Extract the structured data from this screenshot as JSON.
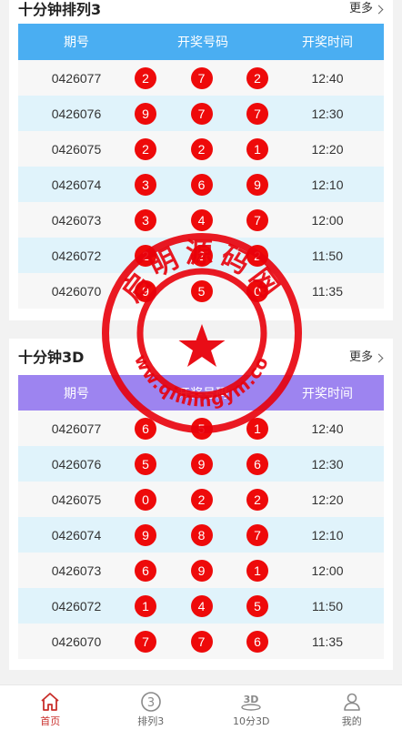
{
  "section1": {
    "title": "十分钟排列3",
    "more": "更多",
    "headers": [
      "期号",
      "开奖号码",
      "开奖时间"
    ],
    "rows": [
      {
        "issue": "0426077",
        "nums": [
          "2",
          "7",
          "2"
        ],
        "time": "12:40"
      },
      {
        "issue": "0426076",
        "nums": [
          "9",
          "7",
          "7"
        ],
        "time": "12:30"
      },
      {
        "issue": "0426075",
        "nums": [
          "2",
          "2",
          "1"
        ],
        "time": "12:20"
      },
      {
        "issue": "0426074",
        "nums": [
          "3",
          "6",
          "9"
        ],
        "time": "12:10"
      },
      {
        "issue": "0426073",
        "nums": [
          "3",
          "4",
          "7"
        ],
        "time": "12:00"
      },
      {
        "issue": "0426072",
        "nums": [
          "2",
          "2",
          "2"
        ],
        "time": "11:50"
      },
      {
        "issue": "0426070",
        "nums": [
          "9",
          "5",
          "0"
        ],
        "time": "11:35"
      }
    ]
  },
  "section2": {
    "title": "十分钟3D",
    "more": "更多",
    "headers": [
      "期号",
      "开奖号码",
      "开奖时间"
    ],
    "rows": [
      {
        "issue": "0426077",
        "nums": [
          "6",
          "5",
          "1"
        ],
        "time": "12:40"
      },
      {
        "issue": "0426076",
        "nums": [
          "5",
          "9",
          "6"
        ],
        "time": "12:30"
      },
      {
        "issue": "0426075",
        "nums": [
          "0",
          "2",
          "2"
        ],
        "time": "12:20"
      },
      {
        "issue": "0426074",
        "nums": [
          "9",
          "8",
          "7"
        ],
        "time": "12:10"
      },
      {
        "issue": "0426073",
        "nums": [
          "6",
          "9",
          "1"
        ],
        "time": "12:00"
      },
      {
        "issue": "0426072",
        "nums": [
          "1",
          "4",
          "5"
        ],
        "time": "11:50"
      },
      {
        "issue": "0426070",
        "nums": [
          "7",
          "7",
          "6"
        ],
        "time": "11:35"
      }
    ]
  },
  "watermark": {
    "top_text": "启明源码网",
    "bottom_text": "www.qimingym.com",
    "color": "#e8000a"
  },
  "tabbar": {
    "items": [
      {
        "label": "首页",
        "icon": "home-icon",
        "active": true
      },
      {
        "label": "排列3",
        "icon": "circle-three-icon",
        "active": false
      },
      {
        "label": "10分3D",
        "icon": "3d-icon",
        "active": false
      },
      {
        "label": "我的",
        "icon": "user-icon",
        "active": false
      }
    ]
  },
  "colors": {
    "header_blue": "#4aaef2",
    "header_purple": "#9d84f0",
    "ball_red": "#ee0a0a",
    "row_alt": "#e0f3fb",
    "tab_active": "#c9302c"
  }
}
